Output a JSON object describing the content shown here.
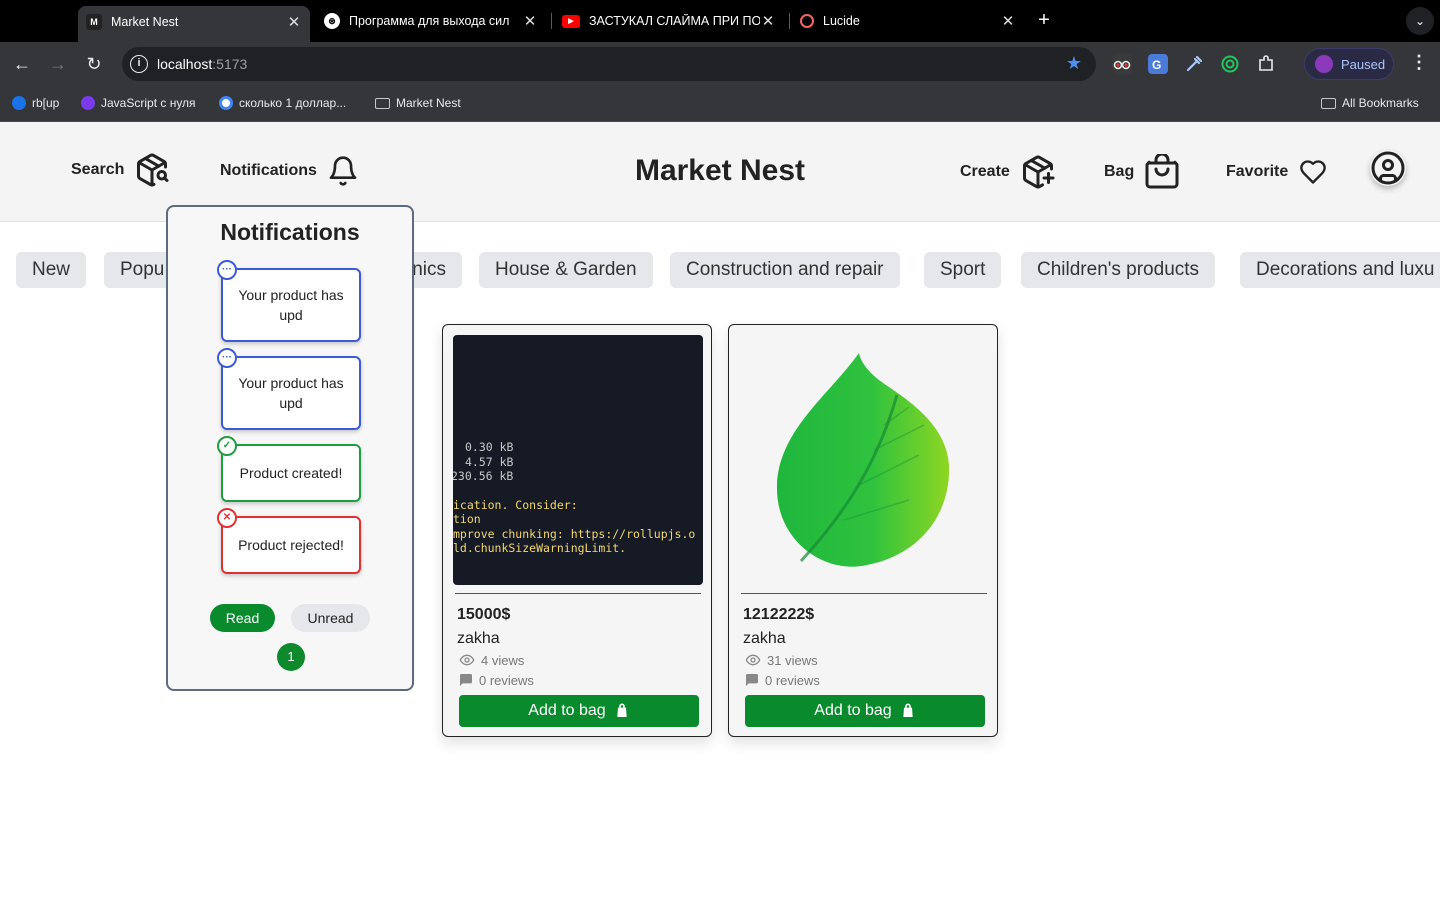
{
  "browser": {
    "tabs": [
      {
        "title": "Market Nest",
        "favicon": "market-nest-favicon",
        "active": true
      },
      {
        "title": "Программа для выхода сил",
        "favicon": "openai-favicon",
        "active": false
      },
      {
        "title": "ЗАСТУКАЛ СЛАЙМА ПРИ ПО",
        "favicon": "youtube-favicon",
        "active": false
      },
      {
        "title": "Lucide",
        "favicon": "lucide-favicon",
        "active": false
      }
    ],
    "url_host": "localhost",
    "url_port": ":5173",
    "profile_status": "Paused",
    "bookmarks": [
      "rb[up",
      "JavaScript с нуля",
      "сколько 1 доллар...",
      "Market Nest"
    ],
    "all_bookmarks": "All Bookmarks"
  },
  "header": {
    "search_label": "Search",
    "notifications_label": "Notifications",
    "brand": "Market Nest",
    "create_label": "Create",
    "bag_label": "Bag",
    "favorite_label": "Favorite"
  },
  "categories": [
    "New",
    "Popu",
    "nics",
    "House & Garden",
    "Construction and repair",
    "Sport",
    "Children's products",
    "Decorations and luxu"
  ],
  "notifications": {
    "title": "Notifications",
    "items": [
      {
        "text": "Your product has upd",
        "status": "info"
      },
      {
        "text": "Your product has upd",
        "status": "info"
      },
      {
        "text": "Product created!",
        "status": "success"
      },
      {
        "text": "Product rejected!",
        "status": "error"
      }
    ],
    "read_label": "Read",
    "unread_label": "Unread",
    "page": "1"
  },
  "products": [
    {
      "price": "15000$",
      "seller": "zakha",
      "views": "4 views",
      "reviews": "0 reviews",
      "button": "Add to bag",
      "image": "terminal-screenshot",
      "image_text": [
        "0.30 kB",
        "4.57 kB",
        "230.56 kB",
        "ication. Consider:",
        "tion",
        "mprove chunking: https://rollupjs.o",
        "ld.chunkSizeWarningLimit."
      ]
    },
    {
      "price": "1212222$",
      "seller": "zakha",
      "views": "31 views",
      "reviews": "0 reviews",
      "button": "Add to bag",
      "image": "green-leaf"
    }
  ],
  "colors": {
    "accent_green": "#098a2c",
    "info_blue": "#3b5bdb",
    "success_green": "#1e9e3e",
    "error_red": "#e03131"
  }
}
